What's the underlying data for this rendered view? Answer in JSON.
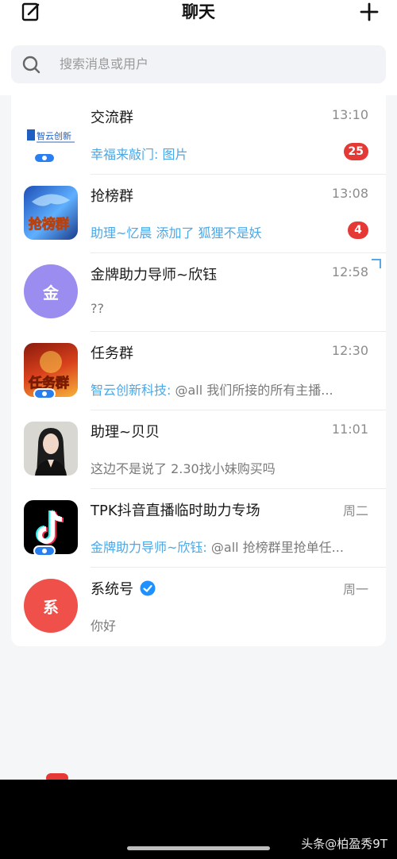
{
  "header": {
    "title": "聊天"
  },
  "search": {
    "placeholder": "搜索消息或用户"
  },
  "chats": [
    {
      "name": "交流群",
      "time": "13:10",
      "sender": "幸福来敲门:",
      "message": " 图片",
      "unread": "25",
      "avatar": "logo-text",
      "logo_text": "智云创新"
    },
    {
      "name": "抢榜群",
      "time": "13:08",
      "sender": "",
      "message": "助理~忆晨 添加了 狐狸不是妖",
      "unread": "4",
      "avatar": "image",
      "avatar_text": "抢榜群"
    },
    {
      "name": "金牌助力导师~欣钰",
      "time": "12:58",
      "sender": "",
      "message": "??",
      "unread": "",
      "avatar": "letter",
      "avatar_letter": "金",
      "avatar_color": "#9b8cf0"
    },
    {
      "name": "任务群",
      "time": "12:30",
      "sender": "智云创新科技:",
      "message": " @all  我们所接的所有主播...",
      "unread": "",
      "avatar": "image",
      "avatar_text": "任务群"
    },
    {
      "name": "助理~贝贝",
      "time": "11:01",
      "sender": "",
      "message": "这边不是说了 2.30找小妹购买吗",
      "unread": "",
      "avatar": "photo"
    },
    {
      "name": "TPK抖音直播临时助力专场",
      "time": "周二",
      "sender": "金牌助力导师~欣钰:",
      "message": " @all 抢榜群里抢单任...",
      "unread": "",
      "avatar": "tiktok-icon"
    },
    {
      "name": "系统号",
      "time": "周一",
      "sender": "",
      "message": "你好",
      "unread": "",
      "avatar": "letter",
      "avatar_letter": "系",
      "avatar_color": "#f0504a",
      "verified": true
    }
  ],
  "tabbar": {
    "badge": ""
  },
  "watermark": "头条@柏盈秀9T"
}
